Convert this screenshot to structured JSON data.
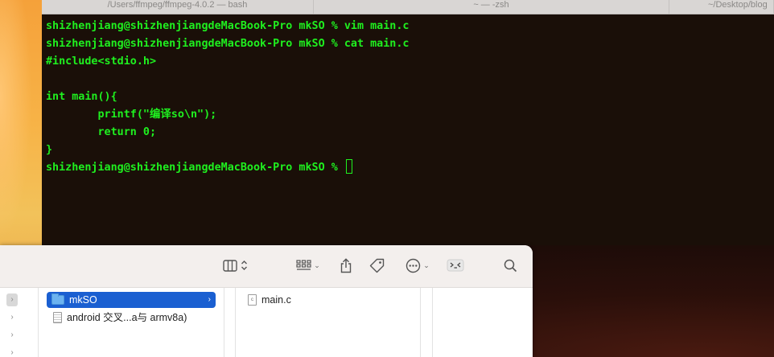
{
  "terminal": {
    "tabs": [
      {
        "label": "/Users/ffmpeg/ffmpeg-4.0.2 — bash"
      },
      {
        "label": "~ — -zsh"
      },
      {
        "label": "~/Desktop/blog"
      }
    ],
    "lines": [
      "shizhenjiang@shizhenjiangdeMacBook-Pro mkSO % vim main.c",
      "shizhenjiang@shizhenjiangdeMacBook-Pro mkSO % cat main.c",
      "#include<stdio.h>",
      "",
      "int main(){",
      "        printf(\"编译so\\n\");",
      "        return 0;",
      "}",
      "shizhenjiang@shizhenjiangdeMacBook-Pro mkSO % "
    ],
    "text_color": "#1ff01f",
    "background": "#1a0f08"
  },
  "finder": {
    "toolbar": {
      "icons": [
        "column-view-icon",
        "group-icon",
        "share-icon",
        "tag-icon",
        "more-actions-icon",
        "terminal-icon",
        "search-icon"
      ]
    },
    "column1": {
      "items": [
        {
          "label": "mkSO",
          "type": "folder",
          "selected": true
        },
        {
          "label": "android 交叉...a与 armv8a)",
          "type": "document",
          "selected": false
        }
      ]
    },
    "column2": {
      "items": [
        {
          "label": "main.c",
          "type": "c-file",
          "icon_text": "c"
        }
      ]
    },
    "selection_color": "#1a5fd1"
  }
}
